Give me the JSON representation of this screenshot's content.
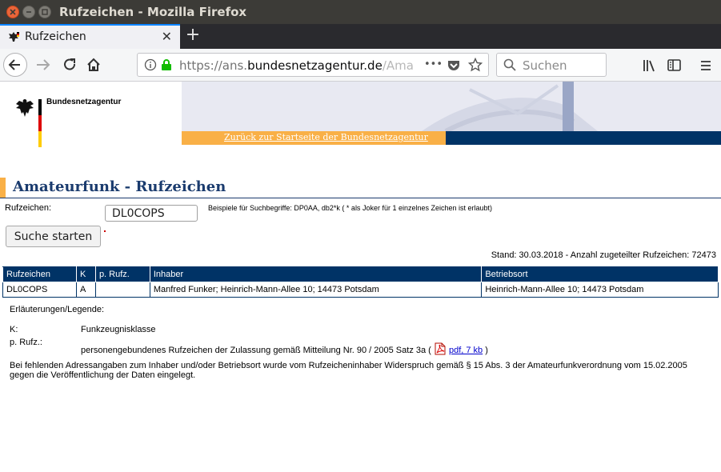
{
  "window": {
    "title": "Rufzeichen - Mozilla Firefox"
  },
  "tab": {
    "title": "Rufzeichen"
  },
  "toolbar": {
    "url_scheme": "https://ans.",
    "url_host": "bundesnetzagentur.de",
    "url_path": "/Ama",
    "more_icon": "•••",
    "search_placeholder": "Suchen"
  },
  "header": {
    "org_name": "Bundesnetzagentur",
    "back_link": "Zurück zur Startseite der Bundesnetzagentur"
  },
  "main": {
    "title": "Amateurfunk - Rufzeichen",
    "form": {
      "label": "Rufzeichen:",
      "value": "DL0COPS",
      "hint": "Beispiele für Suchbegriffe: DP0AA, db2*k ( * als Joker für 1 einzelnes Zeichen ist erlaubt)",
      "submit": "Suche starten"
    },
    "stand": "Stand: 30.03.2018 - Anzahl zugeteilter Rufzeichen: 72473",
    "table": {
      "headers": [
        "Rufzeichen",
        "K",
        "p. Rufz.",
        "Inhaber",
        "Betriebsort"
      ],
      "rows": [
        [
          "DL0COPS",
          "A",
          "",
          "Manfred Funker; Heinrich-Mann-Allee 10; 14473 Potsdam",
          "Heinrich-Mann-Allee 10; 14473 Potsdam"
        ]
      ]
    },
    "legend": {
      "title": "Erläuterungen/Legende:",
      "k_label": "K:",
      "k_value": "Funkzeugnisklasse",
      "p_label": "p. Rufz.:",
      "p_value": "personengebundenes Rufzeichen der Zulassung gemäß Mitteilung Nr. 90 / 2005 Satz 3a (",
      "pdf_link": "pdf, 7 kb",
      "p_close": ")"
    },
    "note": "Bei fehlenden Adressangaben zum Inhaber und/oder Betriebsort wurde vom Rufzeicheninhaber Widerspruch gemäß § 15 Abs. 3 der Amateurfunkverordnung vom 15.02.2005 gegen die Veröffentlichung der Daten eingelegt."
  },
  "colors": {
    "navy": "#003366",
    "orange": "#f9b047",
    "heading": "#1a3b6e",
    "tab_accent": "#0a84ff"
  }
}
